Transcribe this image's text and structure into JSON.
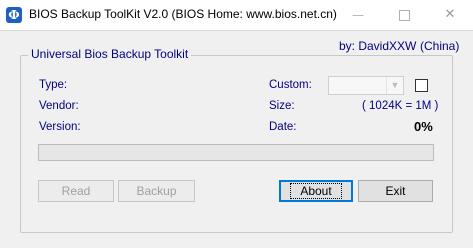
{
  "window": {
    "title": "BIOS Backup ToolKit V2.0 (BIOS Home: www.bios.net.cn)",
    "icon": "bios-app-icon",
    "controls": {
      "minimize": "—",
      "maximize": "□",
      "close": "✕"
    }
  },
  "header": {
    "credit_author": "by: DavidXXW",
    "credit_country": "(China)"
  },
  "group": {
    "title": "Universal Bios Backup Toolkit",
    "fields": {
      "type_label": "Type:",
      "vendor_label": "Vendor:",
      "version_label": "Version:",
      "custom_label": "Custom:",
      "size_label": "Size:",
      "size_value": "( 1024K = 1M )",
      "date_label": "Date:",
      "percent_value": "0%"
    },
    "custom_select": {
      "selected": "",
      "enabled": false
    },
    "custom_checkbox": {
      "checked": false
    },
    "progress": {
      "value": 0
    }
  },
  "buttons": {
    "read": "Read",
    "backup": "Backup",
    "about": "About",
    "exit": "Exit"
  },
  "colors": {
    "label_color": "#000080",
    "icon_color": "#1f5fbf",
    "progress_fill": "#06b025"
  }
}
